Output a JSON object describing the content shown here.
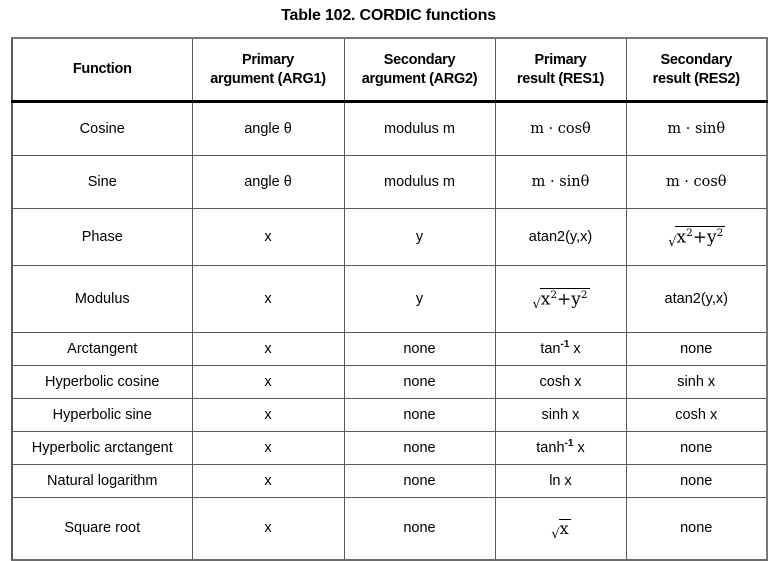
{
  "title": "Table 102. CORDIC functions",
  "table": {
    "columns": [
      {
        "key": "function",
        "label": "Function"
      },
      {
        "key": "arg1",
        "label_line1": "Primary",
        "label_line2": "argument (ARG1)"
      },
      {
        "key": "arg2",
        "label_line1": "Secondary",
        "label_line2": "argument (ARG2)"
      },
      {
        "key": "res1",
        "label_line1": "Primary",
        "label_line2": "result (RES1)"
      },
      {
        "key": "res2",
        "label_line1": "Secondary",
        "label_line2": "result (RES2)"
      }
    ],
    "rows": [
      {
        "function": "Cosine",
        "arg1": "angle θ",
        "arg2": "modulus m",
        "res1": "m · cosθ",
        "res2": "m · sinθ"
      },
      {
        "function": "Sine",
        "arg1": "angle θ",
        "arg2": "modulus m",
        "res1": "m · sinθ",
        "res2": "m · cosθ"
      },
      {
        "function": "Phase",
        "arg1": "x",
        "arg2": "y",
        "res1": "atan2(y,x)",
        "res2": "sqrt(x^2 + y^2)"
      },
      {
        "function": "Modulus",
        "arg1": "x",
        "arg2": "y",
        "res1": "sqrt(x^2 + y^2)",
        "res2": "atan2(y,x)"
      },
      {
        "function": "Arctangent",
        "arg1": "x",
        "arg2": "none",
        "res1": "tan⁻¹ x",
        "res2": "none"
      },
      {
        "function": "Hyperbolic cosine",
        "arg1": "x",
        "arg2": "none",
        "res1": "cosh x",
        "res2": "sinh x"
      },
      {
        "function": "Hyperbolic sine",
        "arg1": "x",
        "arg2": "none",
        "res1": "sinh x",
        "res2": "cosh x"
      },
      {
        "function": "Hyperbolic arctangent",
        "arg1": "x",
        "arg2": "none",
        "res1": "tanh⁻¹ x",
        "res2": "none"
      },
      {
        "function": "Natural logarithm",
        "arg1": "x",
        "arg2": "none",
        "res1": "ln x",
        "res2": "none"
      },
      {
        "function": "Square root",
        "arg1": "x",
        "arg2": "none",
        "res1": "sqrt(x)",
        "res2": "none"
      }
    ],
    "formula_parts": {
      "radical_sign": "√",
      "x_base": "x",
      "y_base": "y",
      "exponent_2": "2",
      "plus": "+",
      "tan_base": "tan",
      "tanh_base": "tanh",
      "inverse_exponent": "-1",
      "var_x": "x",
      "m_dot_cos": "m · cos",
      "m_dot_sin": "m · sin",
      "theta": "θ"
    }
  },
  "colors": {
    "page_background": "#ffffff",
    "text": "#000000",
    "grid_line": "#595959",
    "outer_line": "#6b6b6b",
    "header_rule": "#000000"
  }
}
